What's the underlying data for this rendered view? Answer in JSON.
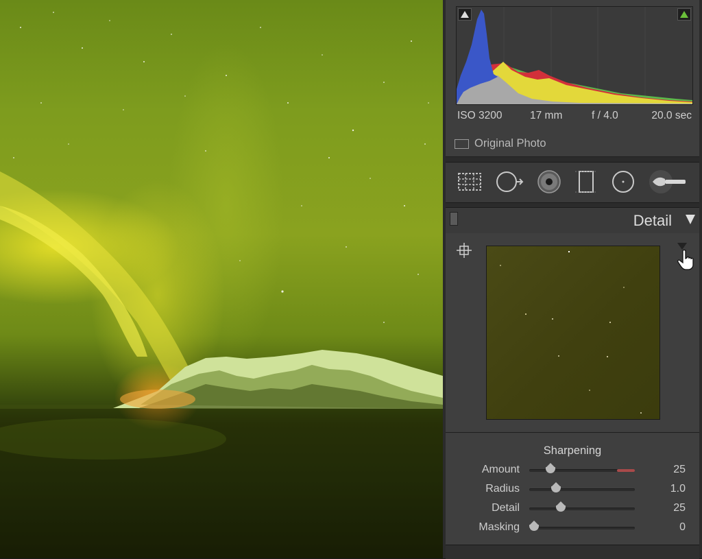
{
  "histogram": {
    "iso": "ISO 3200",
    "focal_length": "17 mm",
    "aperture": "f / 4.0",
    "shutter": "20.0 sec",
    "original_photo_label": "Original Photo",
    "shadow_clip_color": "#dddddd",
    "highlight_clip_color": "#6abf3a"
  },
  "tool_strip": {
    "tools": [
      "crop-overlay-icon",
      "spot-removal-icon",
      "red-eye-icon",
      "graduated-filter-icon",
      "radial-filter-icon",
      "adjustment-brush-icon"
    ]
  },
  "detail": {
    "title": "Detail",
    "sharpening_title": "Sharpening",
    "sliders": [
      {
        "label": "Amount",
        "value": "25",
        "fraction": 0.17
      },
      {
        "label": "Radius",
        "value": "1.0",
        "fraction": 0.23
      },
      {
        "label": "Detail",
        "value": "25",
        "fraction": 0.28
      },
      {
        "label": "Masking",
        "value": "0",
        "fraction": 0.0
      }
    ]
  },
  "colors": {
    "histogram_blue": "#3a57c8",
    "histogram_yellow": "#e3d83a",
    "histogram_red": "#d2303a",
    "histogram_green": "#5db84a",
    "histogram_gray": "#a8a8a8",
    "amount_track_red": "#a94a4a"
  }
}
